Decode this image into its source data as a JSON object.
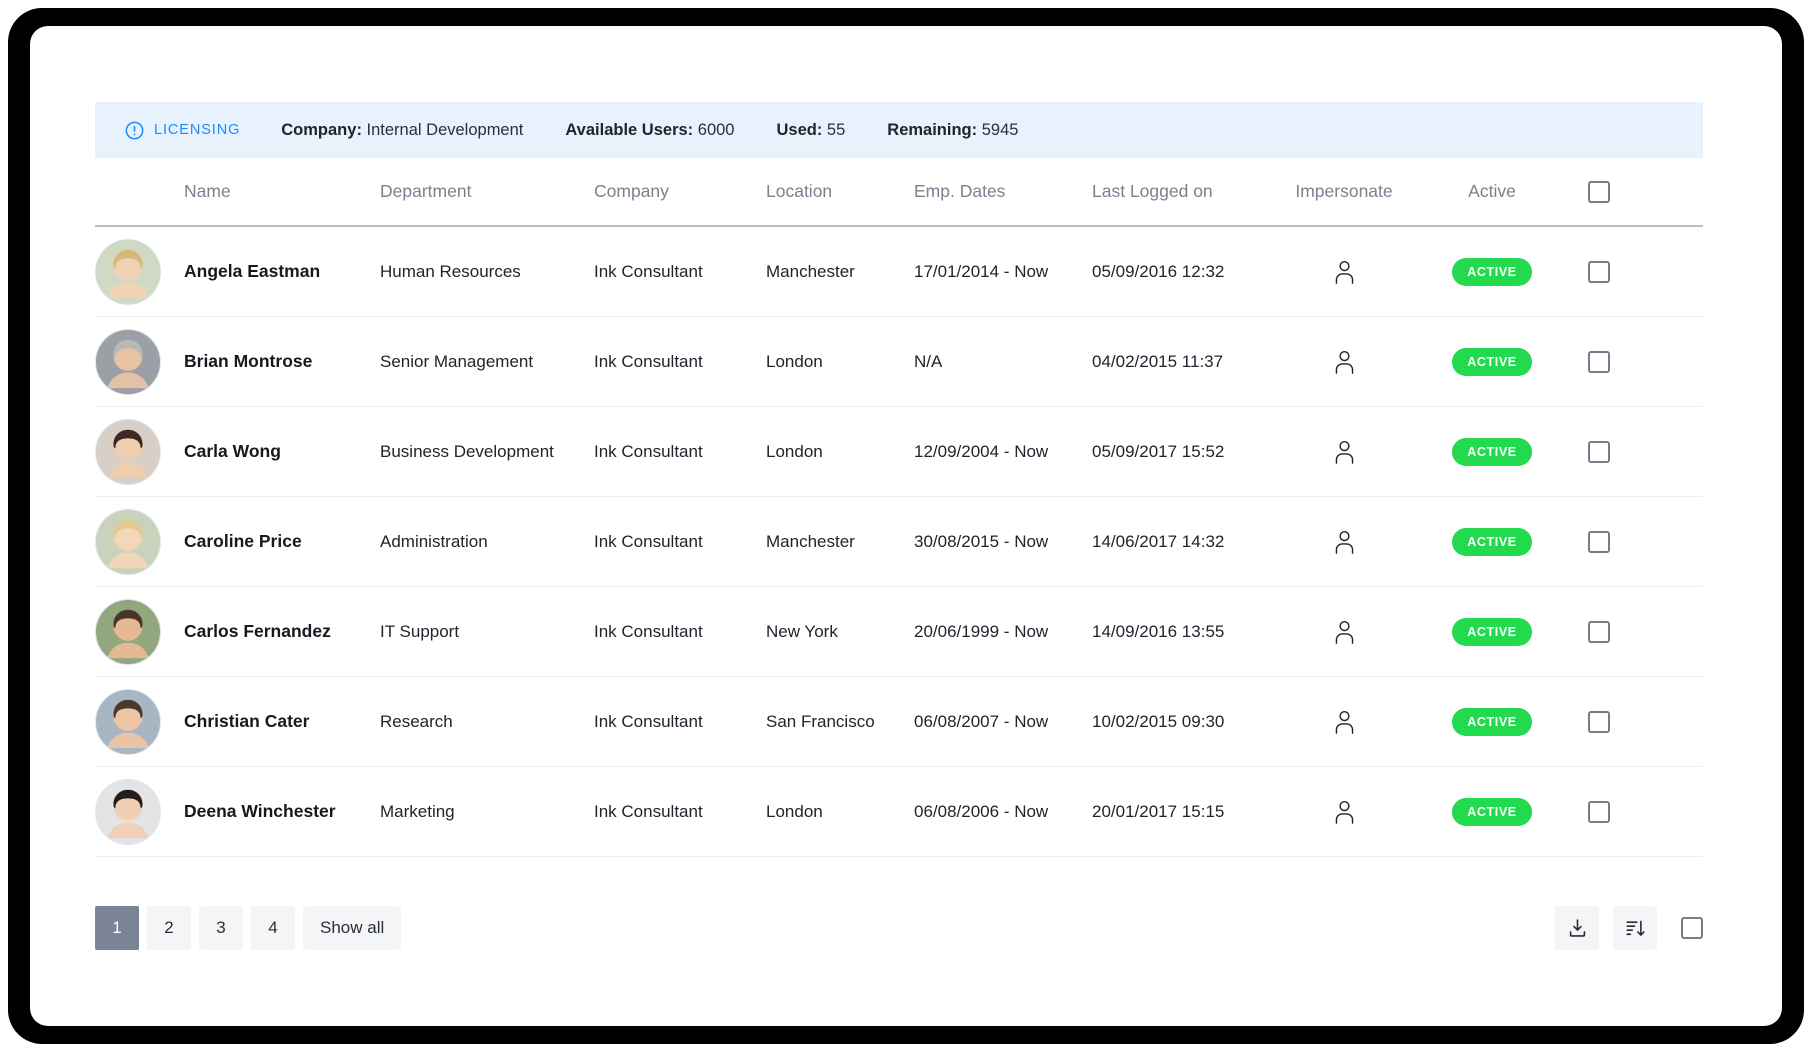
{
  "licensing": {
    "icon": "exclamation-circle-icon",
    "label": "LICENSING",
    "accent_color": "#1a8cff",
    "background_color": "#e8f2fc",
    "stats": [
      {
        "label": "Company:",
        "value": "Internal Development"
      },
      {
        "label": "Available Users:",
        "value": "6000"
      },
      {
        "label": "Used:",
        "value": "55"
      },
      {
        "label": "Remaining:",
        "value": "5945"
      }
    ]
  },
  "table": {
    "headers": {
      "avatar": "",
      "name": "Name",
      "department": "Department",
      "company": "Company",
      "location": "Location",
      "dates": "Emp. Dates",
      "last_logged": "Last Logged on",
      "impersonate": "Impersonate",
      "active": "Active"
    },
    "rows": [
      {
        "name": "Angela Eastman",
        "department": "Human Resources",
        "company": "Ink Consultant",
        "location": "Manchester",
        "dates": "17/01/2014 - Now",
        "last_logged": "05/09/2016 12:32",
        "status": "ACTIVE",
        "avatar_hair": "#d9b679",
        "avatar_skin": "#f2d2b6",
        "avatar_bg": "#cfdac4"
      },
      {
        "name": "Brian Montrose",
        "department": "Senior Management",
        "company": "Ink Consultant",
        "location": "London",
        "dates": "N/A",
        "last_logged": "04/02/2015 11:37",
        "status": "ACTIVE",
        "avatar_hair": "#b8b8b4",
        "avatar_skin": "#e8c3a4",
        "avatar_bg": "#9aa0a6"
      },
      {
        "name": "Carla Wong",
        "department": "Business Development",
        "company": "Ink Consultant",
        "location": "London",
        "dates": "12/09/2004 - Now",
        "last_logged": "05/09/2017 15:52",
        "status": "ACTIVE",
        "avatar_hair": "#3a2a22",
        "avatar_skin": "#f0cdae",
        "avatar_bg": "#d8cfc6"
      },
      {
        "name": "Caroline Price",
        "department": "Administration",
        "company": "Ink Consultant",
        "location": "Manchester",
        "dates": "30/08/2015 - Now",
        "last_logged": "14/06/2017 14:32",
        "status": "ACTIVE",
        "avatar_hair": "#e3c98f",
        "avatar_skin": "#f4d6bb",
        "avatar_bg": "#c9d3bb"
      },
      {
        "name": "Carlos Fernandez",
        "department": "IT Support",
        "company": "Ink Consultant",
        "location": "New York",
        "dates": "20/06/1999 - Now",
        "last_logged": "14/09/2016 13:55",
        "status": "ACTIVE",
        "avatar_hair": "#4a3528",
        "avatar_skin": "#e7b895",
        "avatar_bg": "#93a77f"
      },
      {
        "name": "Christian Cater",
        "department": "Research",
        "company": "Ink Consultant",
        "location": "San Francisco",
        "dates": "06/08/2007 - Now",
        "last_logged": "10/02/2015 09:30",
        "status": "ACTIVE",
        "avatar_hair": "#4b3a2c",
        "avatar_skin": "#eec5a4",
        "avatar_bg": "#a8b6c4"
      },
      {
        "name": "Deena Winchester",
        "department": "Marketing",
        "company": "Ink Consultant",
        "location": "London",
        "dates": "06/08/2006 - Now",
        "last_logged": "20/01/2017 15:15",
        "status": "ACTIVE",
        "avatar_hair": "#241c18",
        "avatar_skin": "#f0d0b4",
        "avatar_bg": "#e2e4e6"
      }
    ]
  },
  "footer": {
    "pages": [
      "1",
      "2",
      "3",
      "4"
    ],
    "active_page": "1",
    "show_all_label": "Show all",
    "download_icon": "download-icon",
    "sort_icon": "sort-descending-icon",
    "select_all_icon": "checkbox-icon"
  },
  "colors": {
    "active_badge": "#23d94e",
    "page_active_bg": "#7b8496",
    "banner_bg": "#e8f2fc",
    "link_blue": "#1a8cff"
  }
}
